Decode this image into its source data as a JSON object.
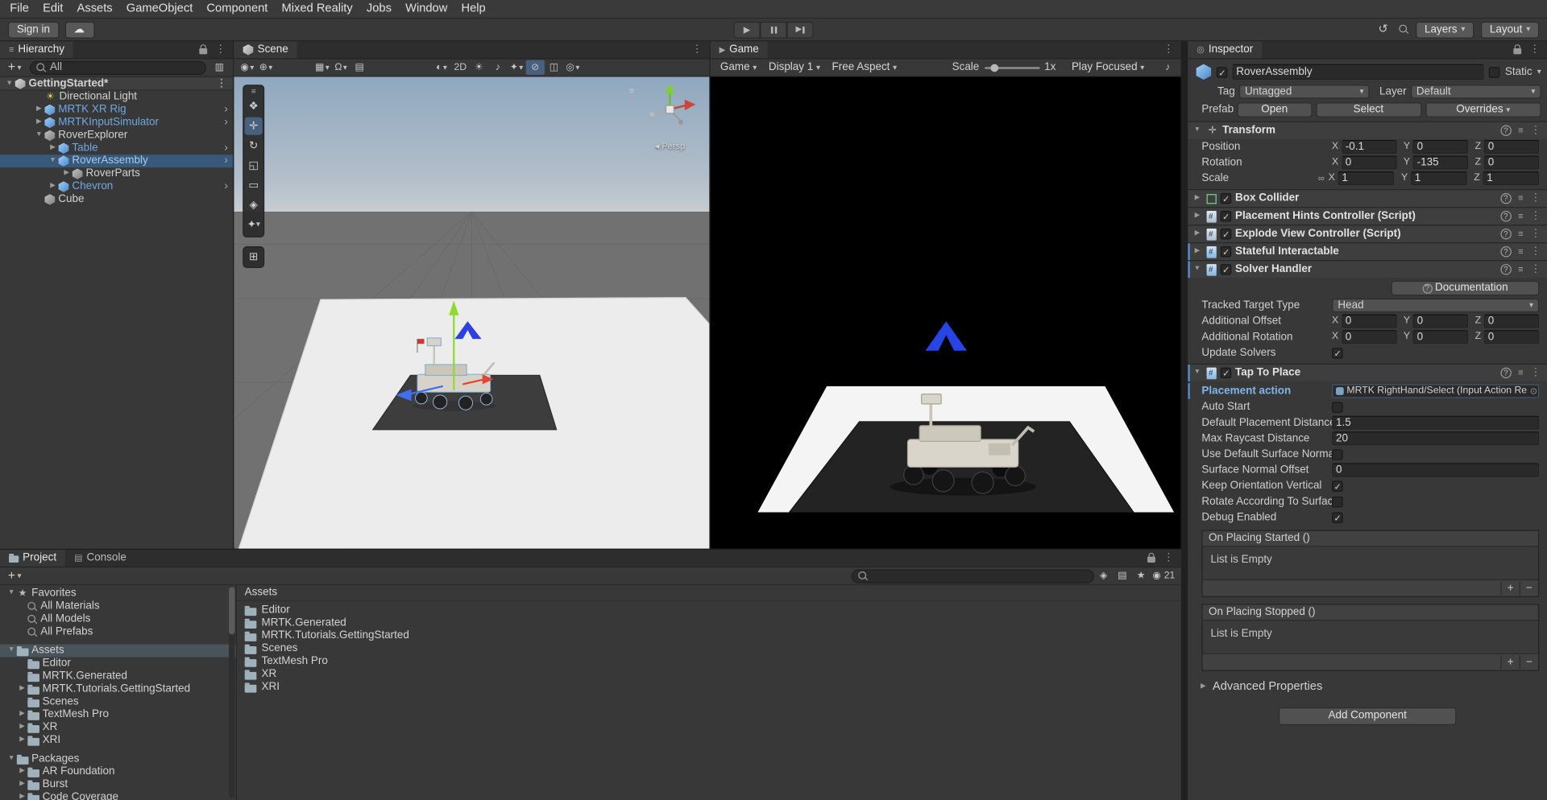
{
  "menubar": {
    "items": [
      "File",
      "Edit",
      "Assets",
      "GameObject",
      "Component",
      "Mixed Reality",
      "Jobs",
      "Window",
      "Help"
    ]
  },
  "topbar": {
    "sign_in": "Sign in",
    "layers": "Layers",
    "layout": "Layout"
  },
  "hierarchy": {
    "tab": "Hierarchy",
    "search_value": "All",
    "scene_name": "GettingStarted*",
    "items": [
      {
        "label": "Directional Light",
        "prefab": false
      },
      {
        "label": "MRTK XR Rig",
        "prefab": true
      },
      {
        "label": "MRTKInputSimulator",
        "prefab": true
      },
      {
        "label": "RoverExplorer",
        "prefab": false
      },
      {
        "label": "Table",
        "prefab": true
      },
      {
        "label": "RoverAssembly",
        "prefab": true,
        "selected": true
      },
      {
        "label": "RoverParts",
        "prefab": false
      },
      {
        "label": "Chevron",
        "prefab": true
      },
      {
        "label": "Cube",
        "prefab": false
      }
    ]
  },
  "scene_view": {
    "tab": "Scene",
    "projection": "Persp",
    "toolbar_2d": "2D"
  },
  "game_view": {
    "tab": "Game",
    "target": "Game",
    "display": "Display 1",
    "aspect": "Free Aspect",
    "scale_label": "Scale",
    "scale_value": "1x",
    "play_mode": "Play Focused"
  },
  "inspector": {
    "tab": "Inspector",
    "name": "RoverAssembly",
    "static_label": "Static",
    "tag_label": "Tag",
    "tag": "Untagged",
    "layer_label": "Layer",
    "layer": "Default",
    "prefab_label": "Prefab",
    "prefab_open": "Open",
    "prefab_select": "Select",
    "prefab_overrides": "Overrides",
    "axes": {
      "x": "X",
      "y": "Y",
      "z": "Z"
    },
    "transform": {
      "title": "Transform",
      "position_label": "Position",
      "rotation_label": "Rotation",
      "scale_label": "Scale",
      "position": {
        "x": "-0.1",
        "y": "0",
        "z": "0"
      },
      "rotation": {
        "x": "0",
        "y": "-135",
        "z": "0"
      },
      "scale": {
        "x": "1",
        "y": "1",
        "z": "1"
      }
    },
    "box_collider": "Box Collider",
    "placement_hints": "Placement Hints Controller (Script)",
    "explode_view": "Explode View Controller (Script)",
    "stateful_interactable": "Stateful Interactable",
    "solver_handler": {
      "title": "Solver Handler",
      "documentation": "Documentation",
      "tracked_target_type_label": "Tracked Target Type",
      "tracked_target_type": "Head",
      "additional_offset_label": "Additional Offset",
      "offset": {
        "x": "0",
        "y": "0",
        "z": "0"
      },
      "additional_rotation_label": "Additional Rotation",
      "rotation": {
        "x": "0",
        "y": "0",
        "z": "0"
      },
      "update_solvers_label": "Update Solvers"
    },
    "tap_to_place": {
      "title": "Tap To Place",
      "placement_action_label": "Placement action",
      "placement_action_value": "MRTK RightHand/Select (Input Action Re",
      "auto_start_label": "Auto Start",
      "default_placement_distance_label": "Default Placement Distance",
      "default_placement_distance": "1.5",
      "max_raycast_distance_label": "Max Raycast Distance",
      "max_raycast_distance": "20",
      "use_default_surface_normal_label": "Use Default Surface Normal Offset",
      "surface_normal_offset_label": "Surface Normal Offset",
      "surface_normal_offset": "0",
      "keep_orientation_vertical_label": "Keep Orientation Vertical",
      "rotate_according_label": "Rotate According To Surface",
      "debug_enabled_label": "Debug Enabled",
      "on_placing_started": "On Placing Started ()",
      "on_placing_stopped": "On Placing Stopped ()",
      "list_empty": "List is Empty",
      "advanced_properties": "Advanced Properties"
    },
    "add_component": "Add Component"
  },
  "project": {
    "tab_project": "Project",
    "tab_console": "Console",
    "favorites_label": "Favorites",
    "favorites": [
      "All Materials",
      "All Models",
      "All Prefabs"
    ],
    "assets_label": "Assets",
    "asset_folders": [
      "Editor",
      "MRTK.Generated",
      "MRTK.Tutorials.GettingStarted",
      "Scenes",
      "TextMesh Pro",
      "XR",
      "XRI"
    ],
    "packages_label": "Packages",
    "package_folders": [
      "AR Foundation",
      "Burst",
      "Code Coverage"
    ],
    "breadcrumb": "Assets",
    "hidden_count": "21"
  },
  "colors": {
    "selection_blue": "#38597a",
    "prefab_text_blue": "#6fa9e0",
    "override_blue": "#5590d9",
    "chevron_blue": "#2b42e2",
    "panel_bg": "#383838"
  },
  "icons": {
    "search-icon": "magnifier css shape",
    "lock-icon": "padlock css shape",
    "more-icon": "⋮",
    "caret-icon": "▾",
    "foldout-open-icon": "▼",
    "foldout-closed-icon": "▶",
    "play-icon": "▶",
    "undo-history-icon": "↺",
    "cloud-icon": "☁",
    "light-icon": "☀",
    "open-prefab-icon": "›",
    "object-picker-icon": "⊙"
  }
}
